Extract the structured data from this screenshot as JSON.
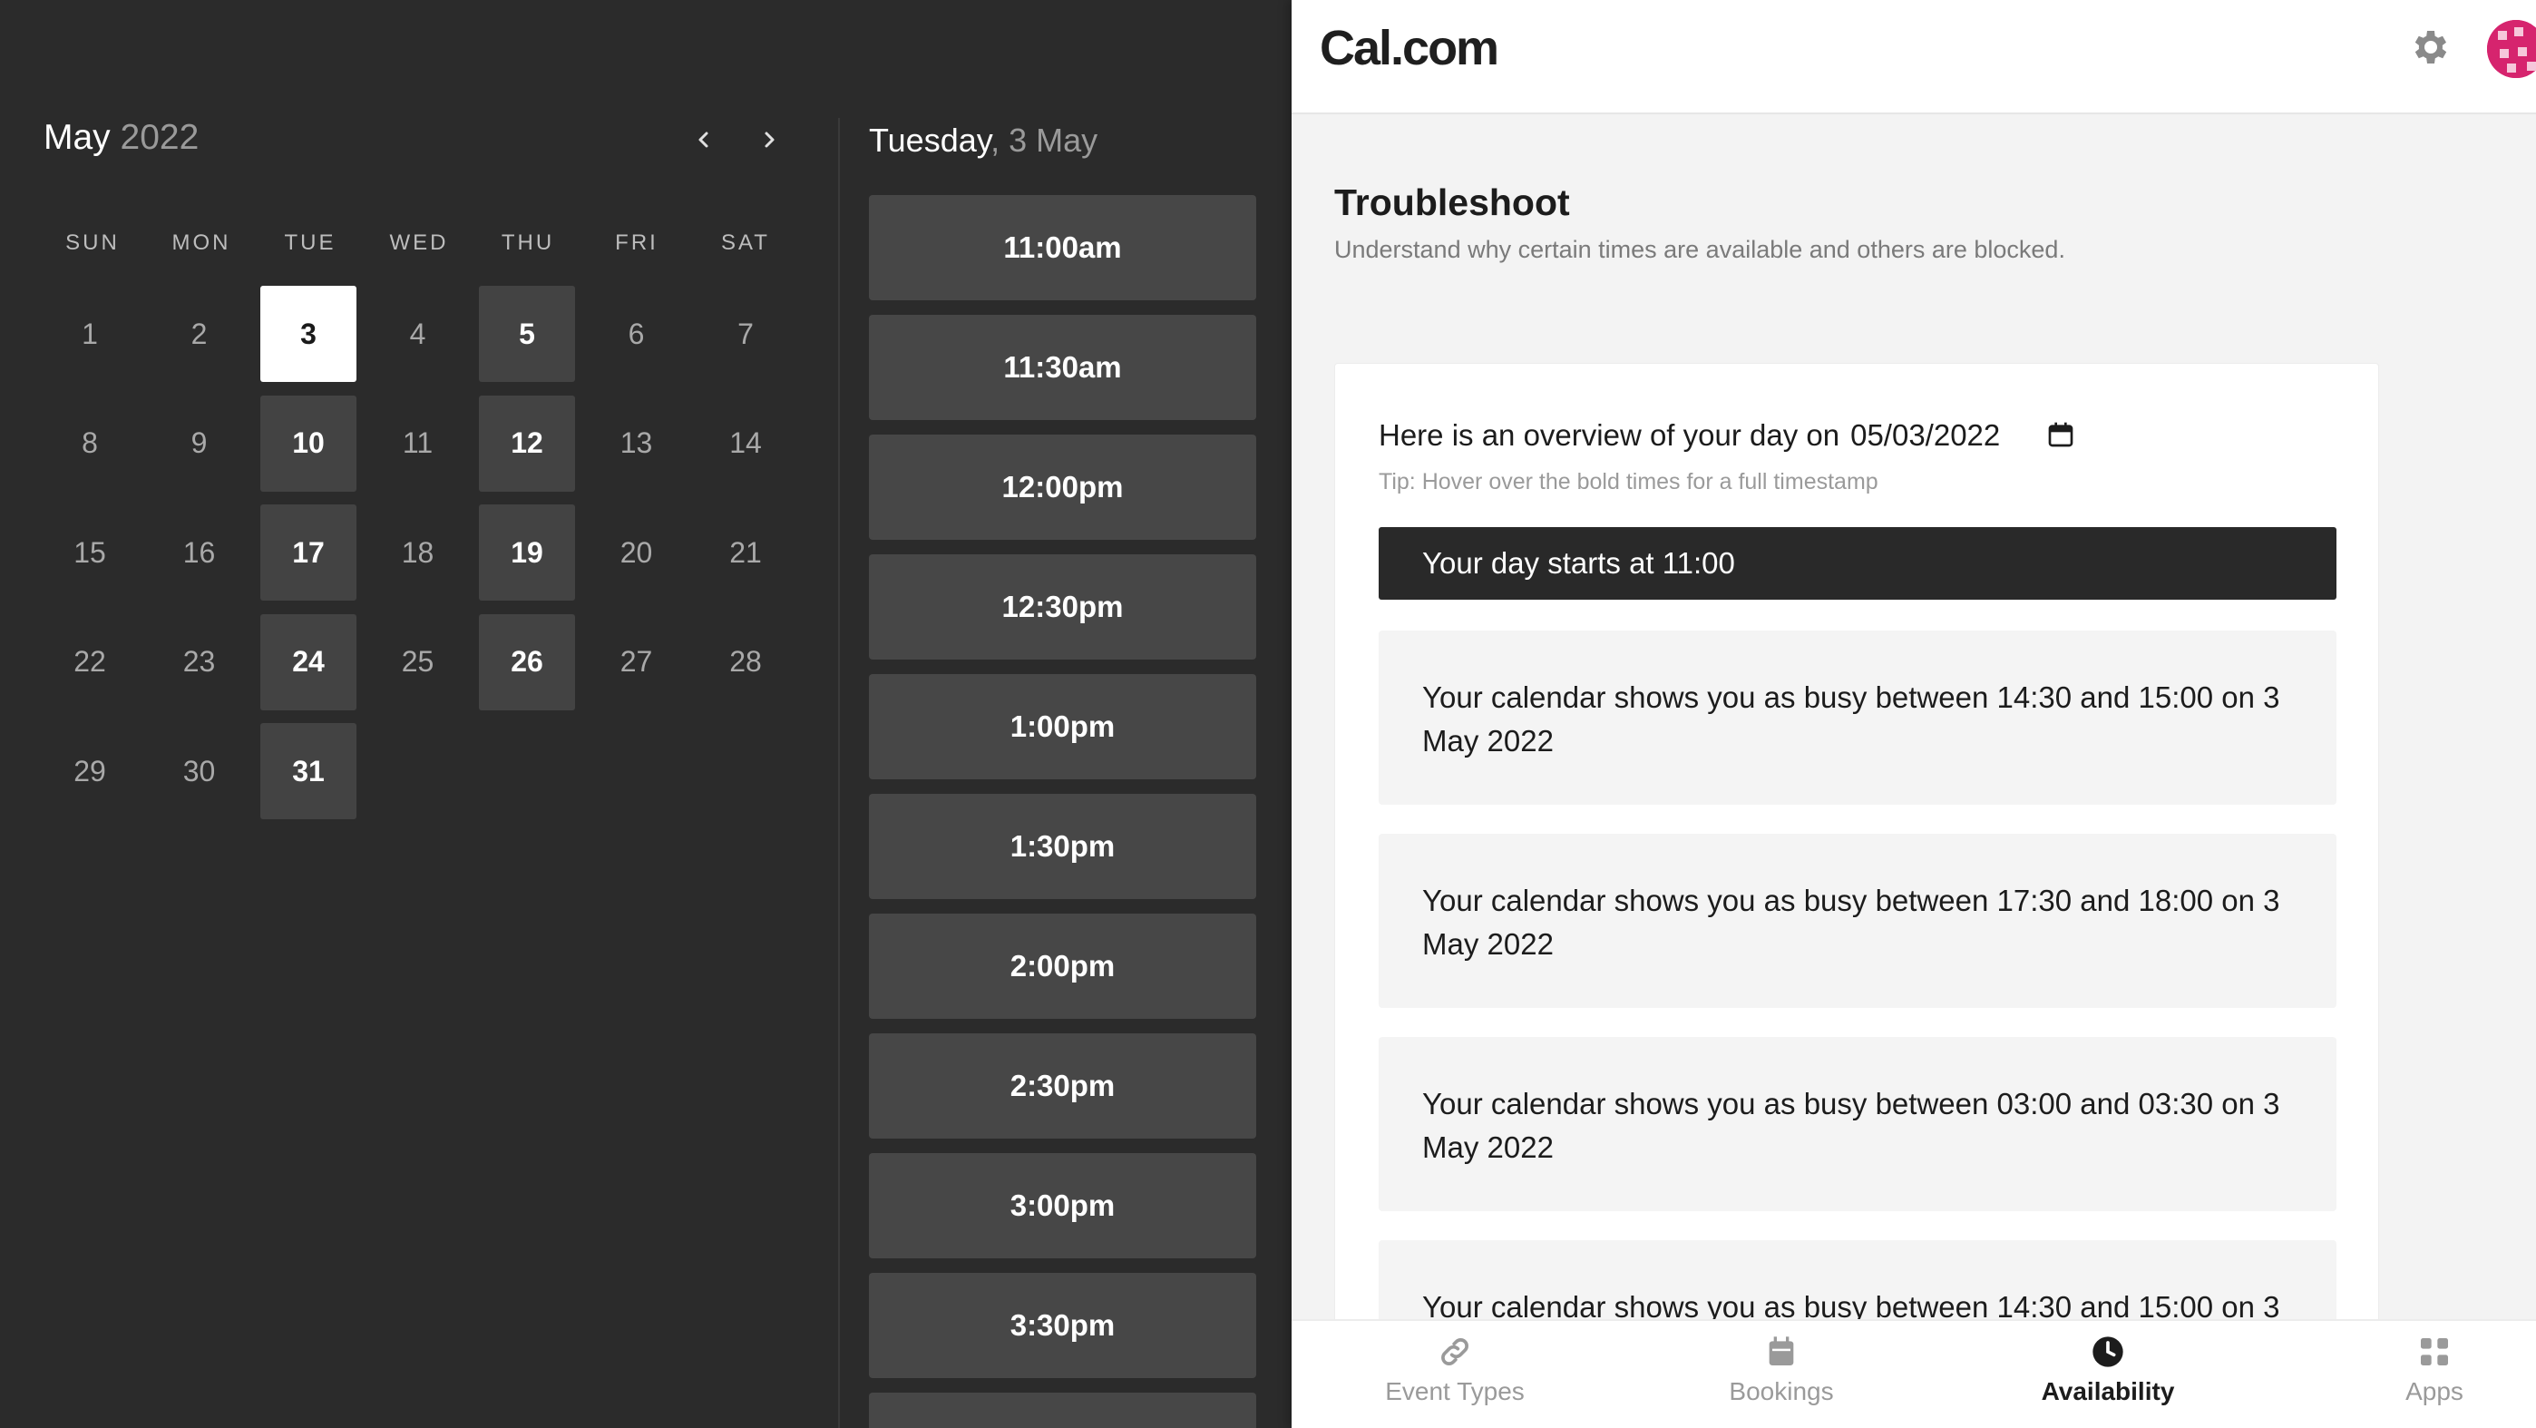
{
  "calendar": {
    "month": "May",
    "year": "2022",
    "weekdays": [
      "SUN",
      "MON",
      "TUE",
      "WED",
      "THU",
      "FRI",
      "SAT"
    ],
    "days": [
      {
        "d": "1",
        "s": "off"
      },
      {
        "d": "2",
        "s": "off"
      },
      {
        "d": "3",
        "s": "selected"
      },
      {
        "d": "4",
        "s": "off"
      },
      {
        "d": "5",
        "s": "avail"
      },
      {
        "d": "6",
        "s": "off"
      },
      {
        "d": "7",
        "s": "off"
      },
      {
        "d": "8",
        "s": "off"
      },
      {
        "d": "9",
        "s": "off"
      },
      {
        "d": "10",
        "s": "avail"
      },
      {
        "d": "11",
        "s": "off"
      },
      {
        "d": "12",
        "s": "avail"
      },
      {
        "d": "13",
        "s": "off"
      },
      {
        "d": "14",
        "s": "off"
      },
      {
        "d": "15",
        "s": "off"
      },
      {
        "d": "16",
        "s": "off"
      },
      {
        "d": "17",
        "s": "avail"
      },
      {
        "d": "18",
        "s": "off"
      },
      {
        "d": "19",
        "s": "avail"
      },
      {
        "d": "20",
        "s": "off"
      },
      {
        "d": "21",
        "s": "off"
      },
      {
        "d": "22",
        "s": "off"
      },
      {
        "d": "23",
        "s": "off"
      },
      {
        "d": "24",
        "s": "avail"
      },
      {
        "d": "25",
        "s": "off"
      },
      {
        "d": "26",
        "s": "avail"
      },
      {
        "d": "27",
        "s": "off"
      },
      {
        "d": "28",
        "s": "off"
      },
      {
        "d": "29",
        "s": "off"
      },
      {
        "d": "30",
        "s": "off"
      },
      {
        "d": "31",
        "s": "avail"
      }
    ],
    "prev_icon": "chevron-left-icon",
    "next_icon": "chevron-right-icon"
  },
  "day_panel": {
    "weekday": "Tuesday",
    "date": ", 3 May",
    "slots": [
      "11:00am",
      "11:30am",
      "12:00pm",
      "12:30pm",
      "1:00pm",
      "1:30pm",
      "2:00pm",
      "2:30pm",
      "3:00pm",
      "3:30pm",
      ""
    ]
  },
  "app": {
    "logo": "Cal.com",
    "settings_icon": "gear-icon",
    "avatar_color": "#d6246e"
  },
  "troubleshoot": {
    "title": "Troubleshoot",
    "subtitle": "Understand why certain times are available and others are blocked.",
    "overview_label": "Here is an overview of your day on",
    "overview_date": "05/03/2022",
    "calendar_icon": "calendar-icon",
    "tip": "Tip: Hover over the bold times for a full timestamp",
    "day_start": "Your day starts at 11:00",
    "busy": [
      "Your calendar shows you as busy between 14:30 and 15:00 on 3 May 2022",
      "Your calendar shows you as busy between 17:30 and 18:00 on 3 May 2022",
      "Your calendar shows you as busy between 03:00 and 03:30 on 3 May 2022",
      "Your calendar shows you as busy between 14:30 and 15:00 on 3"
    ]
  },
  "bottom_nav": [
    {
      "label": "Event Types",
      "icon": "link-icon",
      "active": false
    },
    {
      "label": "Bookings",
      "icon": "calendar-icon",
      "active": false
    },
    {
      "label": "Availability",
      "icon": "clock-icon",
      "active": true
    },
    {
      "label": "Apps",
      "icon": "grid-icon",
      "active": false
    }
  ],
  "colors": {
    "dark_bg": "#2b2b2b",
    "available_day": "#434343",
    "slot_bg": "#474747",
    "light_bg": "#f3f3f3",
    "day_start_bg": "#292929"
  }
}
